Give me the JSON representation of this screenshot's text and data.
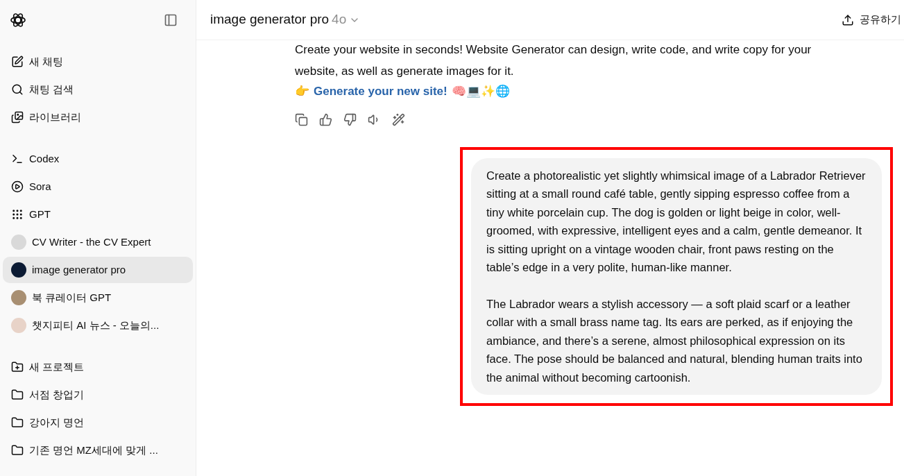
{
  "sidebar": {
    "top_items": [
      {
        "label": "새 채팅",
        "kind": "new-chat"
      },
      {
        "label": "채팅 검색",
        "kind": "search"
      },
      {
        "label": "라이브러리",
        "kind": "library"
      }
    ],
    "apps": [
      {
        "label": "Codex",
        "kind": "codex"
      },
      {
        "label": "Sora",
        "kind": "sora"
      },
      {
        "label": "GPT",
        "kind": "gpt"
      }
    ],
    "gpts": [
      {
        "label": "CV Writer - the CV Expert",
        "color": "#d9d9d9",
        "selected": false
      },
      {
        "label": "image generator pro",
        "color": "#0b1a33",
        "selected": true
      },
      {
        "label": "북 큐레이터 GPT",
        "color": "#a88f72",
        "selected": false
      },
      {
        "label": "챗지피티 AI 뉴스 - 오늘의...",
        "color": "#e8d3c8",
        "selected": false
      }
    ],
    "projects": [
      {
        "label": "새 프로젝트",
        "kind": "new-project"
      },
      {
        "label": "서점 창업기",
        "kind": "folder"
      },
      {
        "label": "강아지 명언",
        "kind": "folder"
      },
      {
        "label": "기존 명언 MZ세대에 맞게 ...",
        "kind": "folder"
      }
    ]
  },
  "header": {
    "title": "image generator pro",
    "model": "4o",
    "share": "공유하기"
  },
  "assistant": {
    "lines": [
      "Create your website in seconds! Website Generator can design, write code, and write copy for your website, as well as generate images for it."
    ],
    "link": "Generate your new site!",
    "pointer": "👉",
    "emojis": "🧠💻✨🌐"
  },
  "user_message": {
    "paragraphs": [
      "Create a photorealistic yet slightly whimsical image of a Labrador Retriever sitting at a small round café table, gently sipping espresso coffee from a tiny white porcelain cup. The dog is golden or light beige in color, well-groomed, with expressive, intelligent eyes and a calm, gentle demeanor. It is sitting upright on a vintage wooden chair, front paws resting on the table’s edge in a very polite, human-like manner.",
      "The Labrador wears a stylish accessory — a soft plaid scarf or a leather collar with a small brass name tag. Its ears are perked, as if enjoying the ambiance, and there’s a serene, almost philosophical expression on its face. The pose should be balanced and natural, blending human traits into the animal without becoming cartoonish."
    ]
  }
}
